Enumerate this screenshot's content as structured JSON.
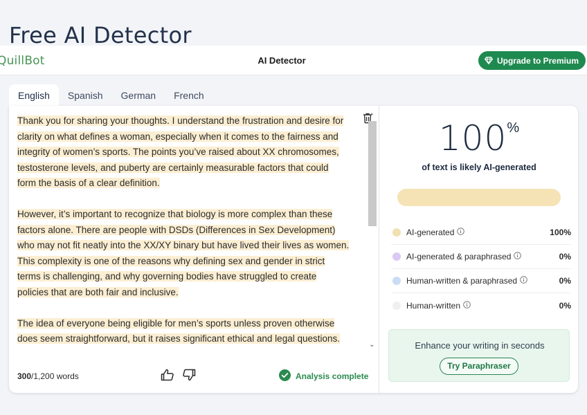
{
  "page": {
    "title": "Free AI Detector"
  },
  "topbar": {
    "brand": "QuillBot",
    "title": "AI Detector",
    "upgrade_label": "Upgrade to Premium"
  },
  "tabs": [
    {
      "label": "English",
      "active": true
    },
    {
      "label": "Spanish",
      "active": false
    },
    {
      "label": "German",
      "active": false
    },
    {
      "label": "French",
      "active": false
    }
  ],
  "editor": {
    "paragraphs": [
      "Thank you for sharing your thoughts. I understand the frustration and desire for clarity on what defines a woman, especially when it comes to the fairness and integrity of women’s sports. The points you’ve raised about XX chromosomes, testosterone levels, and puberty are certainly measurable factors that could form the basis of a clear definition.",
      "However, it’s important to recognize that biology is more complex than these factors alone. There are people with DSDs (Differences in Sex Development) who may not fit neatly into the XX/XY binary but have lived their lives as women. This complexity is one of the reasons why defining sex and gender in strict terms is challenging, and why governing bodies have struggled to create policies that are both fair and inclusive.",
      "The idea of everyone being eligible for men’s sports unless proven otherwise does seem straightforward, but it raises significant ethical and legal questions."
    ],
    "word_count_current": "300",
    "word_count_total": "/1,200 words",
    "status": "Analysis complete"
  },
  "results": {
    "percent": "100",
    "percent_sign": "%",
    "caption": "of text is likely AI-generated",
    "ai_share": 1.0,
    "legend": [
      {
        "label": "AI-generated",
        "value": "100%",
        "color": "#f1e0b0"
      },
      {
        "label": "AI-generated & paraphrased",
        "value": "0%",
        "color": "#dcc9f3"
      },
      {
        "label": "Human-written & paraphrased",
        "value": "0%",
        "color": "#c9dcf6"
      },
      {
        "label": "Human-written",
        "value": "0%",
        "color": "#efefef"
      }
    ],
    "promo_text": "Enhance your writing in seconds",
    "promo_button": "Try Paraphraser"
  },
  "colors": {
    "accent_green": "#1f8a50",
    "highlight": "#fbeed2"
  },
  "icons": [
    "diamond-icon",
    "trash-icon",
    "thumbs-up-icon",
    "thumbs-down-icon",
    "check-circle-icon",
    "info-icon"
  ]
}
